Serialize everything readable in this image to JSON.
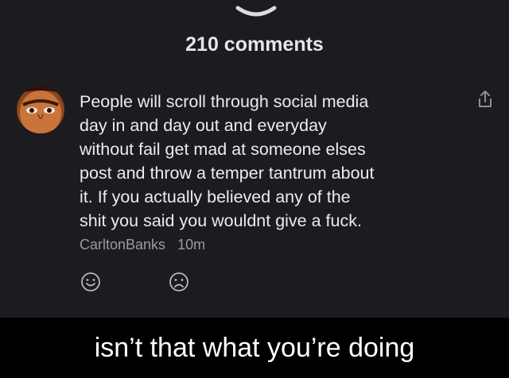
{
  "header": {
    "comments_count": "210 comments",
    "collapse_icon": "chevron-down-icon"
  },
  "comment": {
    "avatar_icon": "user-avatar",
    "lines": [
      "People will scroll through social media",
      "day in and day out and everyday",
      "without fail get mad at someone elses",
      "post and throw a temper tantrum about",
      "it. If you actually believed any of the",
      "shit you said you wouldnt give a fuck."
    ],
    "author": "CarltonBanks",
    "time": "10m",
    "share_icon": "share-icon",
    "reactions": [
      "smile-face-icon",
      "frown-face-icon"
    ]
  },
  "caption": "isn’t that what you’re doing",
  "colors": {
    "background": "#1c1b20",
    "text": "#ececec",
    "meta": "#9a9aa2",
    "caption_bg": "#000000"
  }
}
